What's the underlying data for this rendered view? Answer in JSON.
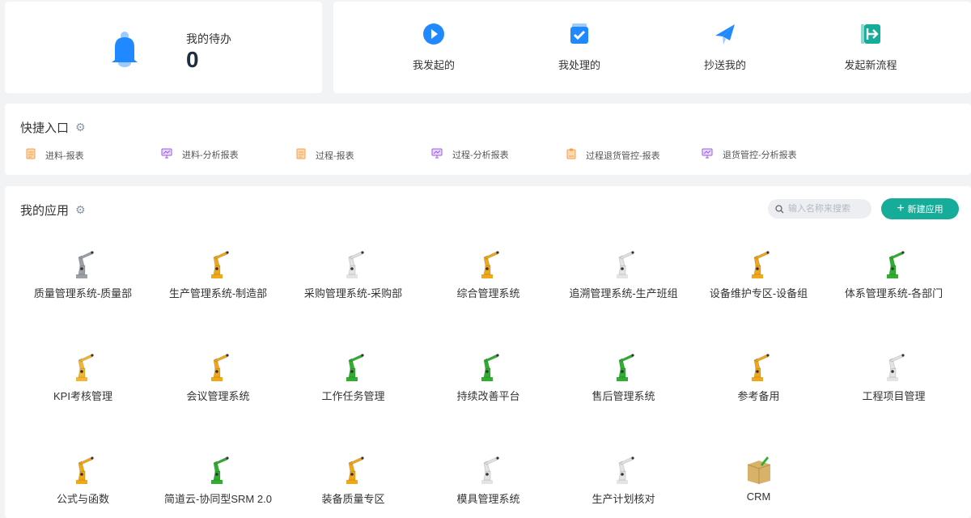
{
  "todo": {
    "label": "我的待办",
    "count": "0"
  },
  "flows": [
    {
      "label": "我发起的",
      "icon": "play-circle-icon"
    },
    {
      "label": "我处理的",
      "icon": "check-calendar-icon"
    },
    {
      "label": "抄送我的",
      "icon": "paper-plane-icon"
    },
    {
      "label": "发起新流程",
      "icon": "exit-arrow-icon"
    }
  ],
  "quick": {
    "title": "快捷入口",
    "items": [
      {
        "label": "进料-报表",
        "icon": "report-icon"
      },
      {
        "label": "进料-分析报表",
        "icon": "analysis-monitor-icon"
      },
      {
        "label": "过程-报表",
        "icon": "report-icon"
      },
      {
        "label": "过程-分析报表",
        "icon": "analysis-monitor-icon"
      },
      {
        "label": "过程退货管控-报表",
        "icon": "clipboard-report-icon"
      },
      {
        "label": "退货管控-分析报表",
        "icon": "analysis-monitor-icon"
      }
    ]
  },
  "apps": {
    "title": "我的应用",
    "search_placeholder": "输入名称来搜索",
    "new_label": "新建应用",
    "items": [
      {
        "label": "质量管理系统-质量部",
        "color": "#9aa0a6"
      },
      {
        "label": "生产管理系统-制造部",
        "color": "#f0a818"
      },
      {
        "label": "采购管理系统-采购部",
        "color": "#e4e4e4"
      },
      {
        "label": "综合管理系统",
        "color": "#f0a818"
      },
      {
        "label": "追溯管理系统-生产班组",
        "color": "#e4e4e4"
      },
      {
        "label": "设备维护专区-设备组",
        "color": "#f0a818"
      },
      {
        "label": "体系管理系统-各部门",
        "color": "#2fae2f"
      },
      {
        "label": "KPI考核管理",
        "color": "#f3b632"
      },
      {
        "label": "会议管理系统",
        "color": "#f0a818"
      },
      {
        "label": "工作任务管理",
        "color": "#2fae2f"
      },
      {
        "label": "持续改善平台",
        "color": "#2fae2f"
      },
      {
        "label": "售后管理系统",
        "color": "#2fae2f"
      },
      {
        "label": "参考备用",
        "color": "#f0a818"
      },
      {
        "label": "工程项目管理",
        "color": "#e4e4e4"
      },
      {
        "label": "公式与函数",
        "color": "#f0a818"
      },
      {
        "label": "简道云-协同型SRM 2.0",
        "color": "#2fae2f"
      },
      {
        "label": "装备质量专区",
        "color": "#f0a818"
      },
      {
        "label": "模具管理系统",
        "color": "#e4e4e4"
      },
      {
        "label": "生产计划核对",
        "color": "#e4e4e4"
      },
      {
        "label": "CRM",
        "color": "#d9b26a"
      }
    ]
  }
}
